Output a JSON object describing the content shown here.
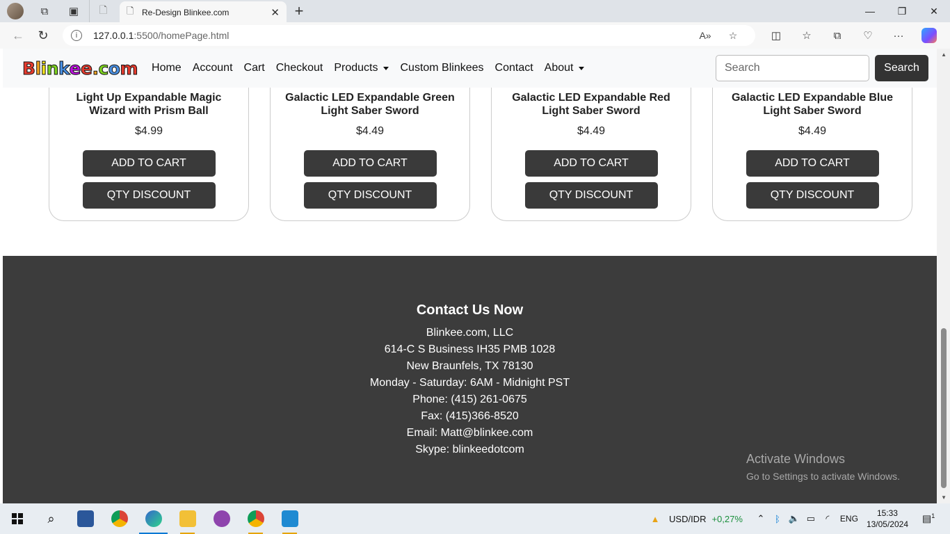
{
  "browser": {
    "tab_title": "Re-Design Blinkee.com",
    "url_host": "127.0.0.1",
    "url_rest": ":5500/homePage.html"
  },
  "navbar": {
    "logo": [
      "B",
      "l",
      "i",
      "n",
      "k",
      "e",
      "e",
      ".",
      "c",
      "o",
      "m"
    ],
    "links": [
      {
        "label": "Home"
      },
      {
        "label": "Account"
      },
      {
        "label": "Cart"
      },
      {
        "label": "Checkout"
      },
      {
        "label": "Products",
        "dropdown": true
      },
      {
        "label": "Custom Blinkees"
      },
      {
        "label": "Contact"
      },
      {
        "label": "About",
        "dropdown": true
      }
    ],
    "search_placeholder": "Search",
    "search_button": "Search"
  },
  "products": [
    {
      "title": "Light Up Expandable Magic Wizard with Prism Ball",
      "price": "$4.99",
      "add": "ADD TO CART",
      "qty": "QTY DISCOUNT"
    },
    {
      "title": "Galactic LED Expandable Green Light Saber Sword",
      "price": "$4.49",
      "add": "ADD TO CART",
      "qty": "QTY DISCOUNT"
    },
    {
      "title": "Galactic LED Expandable Red Light Saber Sword",
      "price": "$4.49",
      "add": "ADD TO CART",
      "qty": "QTY DISCOUNT"
    },
    {
      "title": "Galactic LED Expandable Blue Light Saber Sword",
      "price": "$4.49",
      "add": "ADD TO CART",
      "qty": "QTY DISCOUNT"
    }
  ],
  "footer": {
    "heading": "Contact Us Now",
    "lines": [
      "Blinkee.com, LLC",
      "614-C S Business IH35 PMB 1028",
      "New Braunfels, TX 78130",
      "Monday - Saturday: 6AM - Midnight PST",
      "Phone: (415) 261-0675",
      "Fax: (415)366-8520",
      "Email: Matt@blinkee.com",
      "Skype: blinkeedotcom"
    ]
  },
  "watermark": {
    "line1": "Activate Windows",
    "line2": "Go to Settings to activate Windows."
  },
  "taskbar": {
    "currency": "USD/IDR",
    "change": "+0,27%",
    "lang": "ENG",
    "time": "15:33",
    "date": "13/05/2024",
    "notifications": "1"
  }
}
